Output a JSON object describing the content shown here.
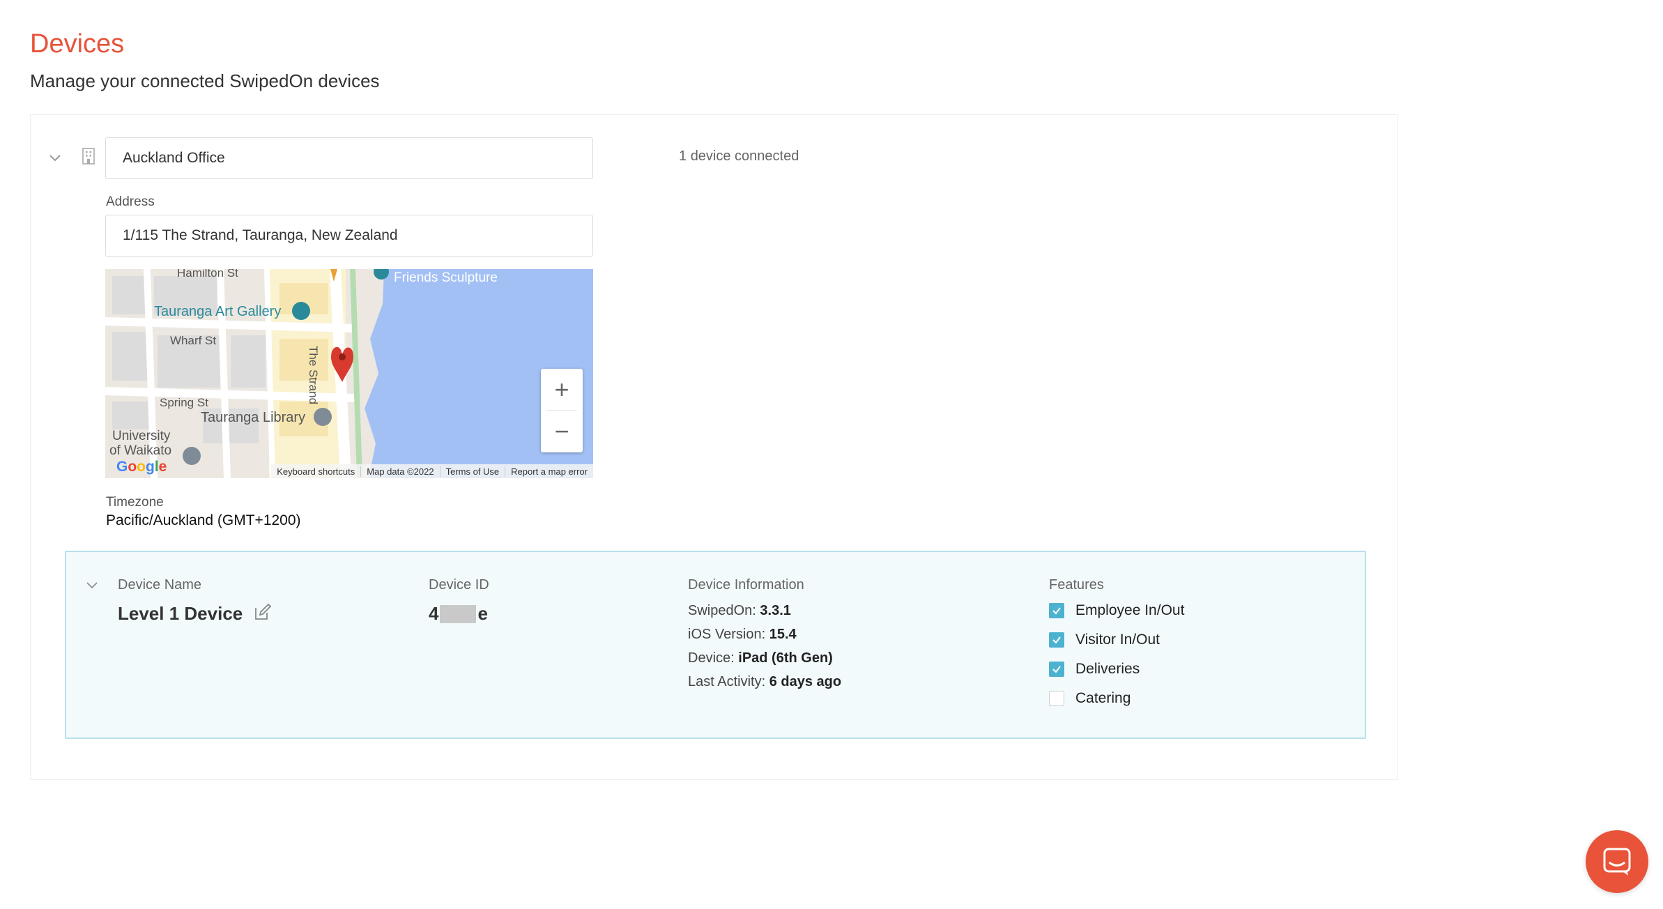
{
  "header": {
    "title": "Devices",
    "subtitle": "Manage your connected SwipedOn devices"
  },
  "location": {
    "name_value": "Auckland Office",
    "address_label": "Address",
    "address_value": "1/115 The Strand, Tauranga, New Zealand",
    "device_count_number": "1",
    "device_count_text": "device connected",
    "timezone_label": "Timezone",
    "timezone_value": "Pacific/Auckland (GMT+1200)"
  },
  "map": {
    "streets": [
      "Hamilton St",
      "Wharf St",
      "Spring St",
      "The Strand"
    ],
    "pois": [
      "Tauranga Art Gallery",
      "Tauranga Library",
      "University",
      "of Waikato",
      "Friends Sculpture"
    ],
    "zoom_in": "+",
    "zoom_out": "−",
    "footer": [
      "Keyboard shortcuts",
      "Map data ©2022",
      "Terms of Use",
      "Report a map error"
    ],
    "logo": "Google",
    "colors": {
      "water": "#a3c0f5",
      "land": "#ece8e1",
      "block": "#dddcdc",
      "highlight": "#fbf2cf",
      "pin": "#d93a2f"
    }
  },
  "device": {
    "name_label": "Device Name",
    "name_value": "Level 1 Device",
    "id_label": "Device ID",
    "id_prefix": "4",
    "id_suffix": "e",
    "info_label": "Device Information",
    "info": [
      {
        "key": "SwipedOn:",
        "value": "3.3.1"
      },
      {
        "key": "iOS Version:",
        "value": "15.4"
      },
      {
        "key": "Device:",
        "value": "iPad (6th Gen)"
      },
      {
        "key": "Last Activity:",
        "value": "6 days ago"
      }
    ],
    "features_label": "Features",
    "features": [
      {
        "label": "Employee In/Out",
        "checked": true
      },
      {
        "label": "Visitor In/Out",
        "checked": true
      },
      {
        "label": "Deliveries",
        "checked": true
      },
      {
        "label": "Catering",
        "checked": false
      }
    ]
  },
  "colors": {
    "accent": "#e8533a",
    "check": "#4db2cf",
    "panel_border": "#b7e0ea",
    "panel_bg": "#f3fafc"
  }
}
